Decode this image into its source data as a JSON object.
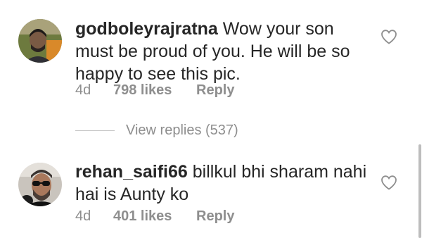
{
  "comments": [
    {
      "username": "godboleyrajratna",
      "text": "Wow your son must be proud of you. He will be so happy to see this pic.",
      "time": "4d",
      "likes": "798 likes",
      "reply_label": "Reply",
      "avatar_icon": "user-avatar-photo",
      "like_icon": "heart-outline-icon"
    },
    {
      "username": "rehan_saifi66",
      "text": "billkul bhi sharam nahi hai is Aunty ko",
      "time": "4d",
      "likes": "401 likes",
      "reply_label": "Reply",
      "avatar_icon": "user-avatar-photo",
      "like_icon": "heart-outline-icon"
    }
  ],
  "view_replies": {
    "label": "View replies (537)"
  },
  "colors": {
    "text": "#262626",
    "secondary": "#8e8e8e",
    "divider": "#c7c7c7"
  }
}
